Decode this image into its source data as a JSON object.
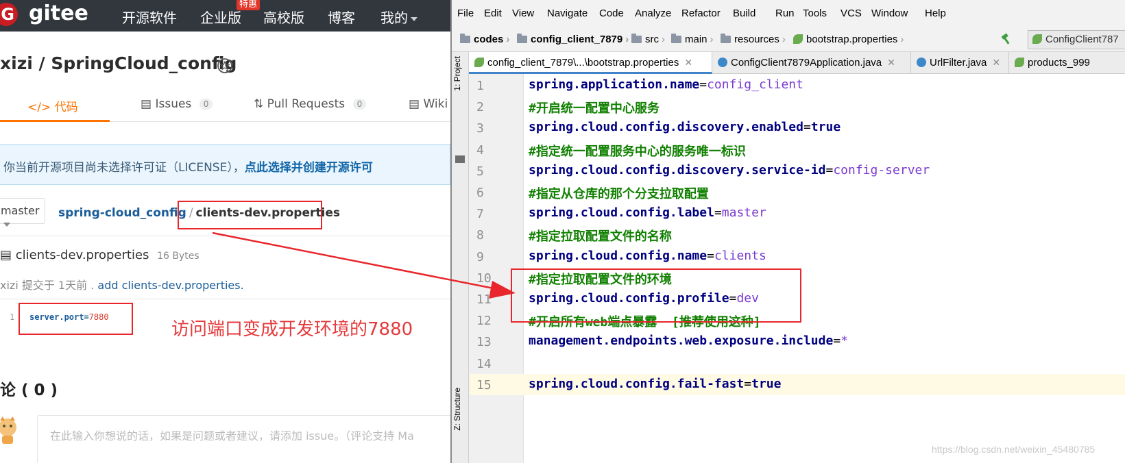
{
  "gitee": {
    "logo": "gitee",
    "nav": [
      "开源软件",
      "企业版",
      "高校版",
      "博客",
      "我的"
    ],
    "nav_badge": "特惠",
    "repo_title": "xizi / SpringCloud_config",
    "tabs": [
      {
        "label": "代码",
        "icon": "code-icon"
      },
      {
        "label": "Issues",
        "count": "0",
        "icon": "issues-icon"
      },
      {
        "label": "Pull Requests",
        "count": "0",
        "icon": "pull-request-icon"
      },
      {
        "label": "Wiki",
        "icon": "wiki-icon"
      }
    ],
    "license_notice": "你当前开源项目尚未选择许可证（LICENSE），",
    "license_link": "点此选择并创建开源许可",
    "branch": "master",
    "path_repo": "spring-cloud_config",
    "path_sep": "/",
    "path_file": "clients-dev.properties",
    "file_name": "clients-dev.properties",
    "file_size": "16 Bytes",
    "commit_prefix": "xizi 提交于 1天前 .",
    "commit_message": "add clients-dev.properties.",
    "code_line_no": "1",
    "code_key": "server.port=",
    "code_value": "7880",
    "annotation": "访问端口变成开发环境的7880",
    "comments_title": "论 ( 0 )",
    "comment_placeholder": "在此输入你想说的话，如果是问题或者建议，请添加 issue。（评论支持 Ma"
  },
  "ide": {
    "menu": [
      "File",
      "Edit",
      "View",
      "Navigate",
      "Code",
      "Analyze",
      "Refactor",
      "Build",
      "Run",
      "Tools",
      "VCS",
      "Window",
      "Help"
    ],
    "breadcrumbs": [
      "codes",
      "config_client_7879",
      "src",
      "main",
      "resources",
      "bootstrap.properties"
    ],
    "run_config": "ConfigClient787",
    "tabs": [
      "config_client_7879\\...\\bootstrap.properties",
      "ConfigClient7879Application.java",
      "UrlFilter.java",
      "products_999"
    ],
    "side_labels": [
      "1: Project",
      "Z: Structure"
    ],
    "lines": [
      {
        "n": "1",
        "key": "spring.application.name",
        "value": "config_client",
        "vtype": "str"
      },
      {
        "n": "2",
        "comment": "#开启统一配置中心服务"
      },
      {
        "n": "3",
        "key": "spring.cloud.config.discovery.enabled",
        "value": "true",
        "vtype": "bool"
      },
      {
        "n": "4",
        "comment": "#指定统一配置服务中心的服务唯一标识"
      },
      {
        "n": "5",
        "key": "spring.cloud.config.discovery.service-id",
        "value": "config-server",
        "vtype": "str"
      },
      {
        "n": "6",
        "comment": "#指定从仓库的那个分支拉取配置"
      },
      {
        "n": "7",
        "key": "spring.cloud.config.label",
        "value": "master",
        "vtype": "str"
      },
      {
        "n": "8",
        "comment": "#指定拉取配置文件的名称"
      },
      {
        "n": "9",
        "key": "spring.cloud.config.name",
        "value": "clients",
        "vtype": "str"
      },
      {
        "n": "10",
        "comment": "#指定拉取配置文件的环境"
      },
      {
        "n": "11",
        "key": "spring.cloud.config.profile",
        "value": "dev",
        "vtype": "str"
      },
      {
        "n": "12",
        "comment": "#开启所有web端点暴露  [推荐使用这种]"
      },
      {
        "n": "13",
        "key": "management.endpoints.web.exposure.include",
        "value": "*",
        "vtype": "str"
      },
      {
        "n": "14"
      },
      {
        "n": "15",
        "key": "spring.cloud.config.fail-fast",
        "value": "true",
        "vtype": "bool",
        "highlight": true
      }
    ],
    "watermark": "https://blog.csdn.net/weixin_45480785"
  },
  "colors": {
    "gitee_nav_bg": "#32373e",
    "gitee_accent": "#fe7300",
    "annotation_red": "#e8262b",
    "ide_key": "#000080",
    "ide_comment": "#108000",
    "ide_value": "#7a3ad1"
  }
}
